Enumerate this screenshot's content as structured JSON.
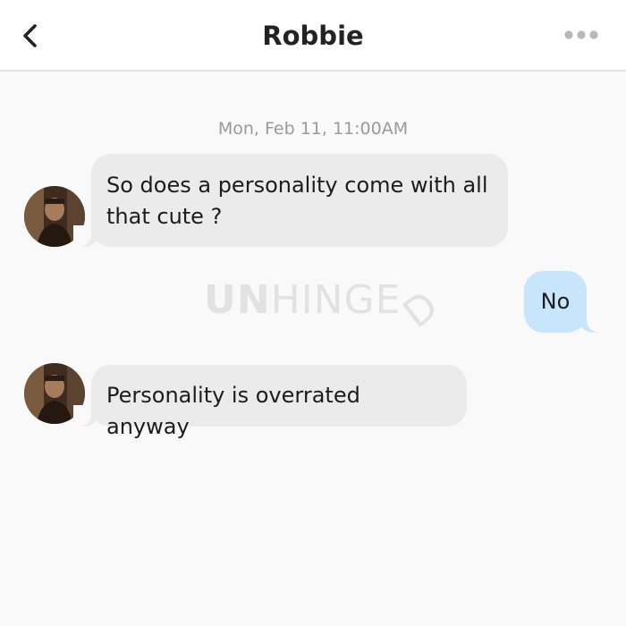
{
  "header": {
    "title": "Robbie",
    "back_icon": "chevron-left-icon",
    "more_icon": "more-horizontal-icon"
  },
  "chat": {
    "timestamp": "Mon, Feb 11, 11:00AM",
    "messages": [
      {
        "direction": "incoming",
        "text": "So does a personality come with all that cute ?"
      },
      {
        "direction": "outgoing",
        "text": "No"
      },
      {
        "direction": "incoming",
        "text": "Personality is overrated anyway"
      }
    ]
  },
  "watermark": {
    "bold": "UN",
    "light": "HINGE",
    "tail": "D"
  },
  "colors": {
    "incoming_bubble": "#ebebeb",
    "outgoing_bubble": "#c7e5fb",
    "background": "#f9f9f9",
    "header": "#ffffff"
  }
}
